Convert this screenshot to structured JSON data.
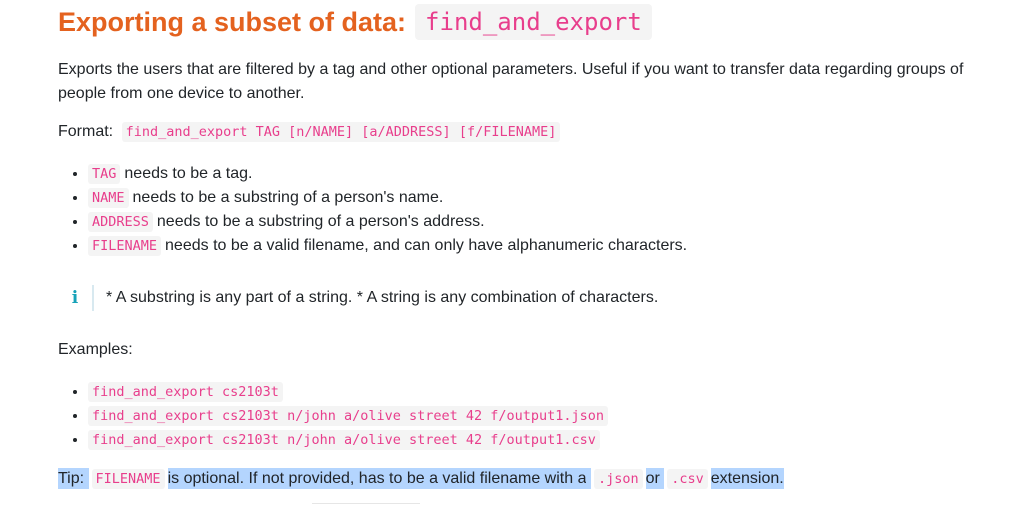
{
  "heading": {
    "text": "Exporting a subset of data:",
    "code": "find_and_export"
  },
  "description": "Exports the users that are filtered by a tag and other optional parameters. Useful if you want to transfer data regarding groups of people from one device to another.",
  "format": {
    "label": "Format:",
    "code": "find_and_export TAG [n/NAME] [a/ADDRESS] [f/FILENAME]"
  },
  "params": [
    {
      "code": "TAG",
      "text": "needs to be a tag."
    },
    {
      "code": "NAME",
      "text": "needs to be a substring of a person's name."
    },
    {
      "code": "ADDRESS",
      "text": "needs to be a substring of a person's address."
    },
    {
      "code": "FILENAME",
      "text": "needs to be a valid filename, and can only have alphanumeric characters."
    }
  ],
  "info": {
    "icon_glyph": "i",
    "icon": "info-icon",
    "text": "* A substring is any part of a string. * A string is any combination of characters."
  },
  "examples": {
    "label": "Examples:",
    "items": [
      "find_and_export cs2103t",
      "find_and_export cs2103t n/john a/olive street 42 f/output1.json",
      "find_and_export cs2103t n/john a/olive street 42 f/output1.csv"
    ]
  },
  "tip": {
    "prefix": "Tip:",
    "code1": "FILENAME",
    "text1": "is optional. If not provided, has to be a valid filename with a",
    "code2": ".json",
    "text2": "or",
    "code3": ".csv",
    "text3": "extension."
  },
  "colors": {
    "heading": "#e4621f",
    "code_text": "#e83e8c",
    "code_bg": "#f4f4f4",
    "info_icon": "#17a2b8",
    "selection_highlight": "#b4d5fe"
  }
}
